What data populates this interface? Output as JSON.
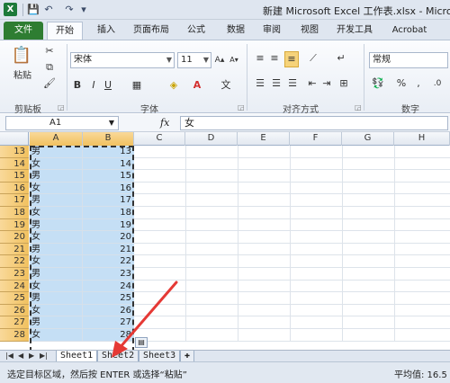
{
  "window": {
    "title": "新建 Microsoft Excel 工作表.xlsx - Microsoft"
  },
  "ribbon_tabs": [
    "文件",
    "开始",
    "插入",
    "页面布局",
    "公式",
    "数据",
    "审阅",
    "视图",
    "开发工具",
    "Acrobat"
  ],
  "clipboard": {
    "paste_label": "粘贴",
    "group_label": "剪贴板"
  },
  "font": {
    "name": "宋体",
    "size": "11",
    "group_label": "字体",
    "bold": "B",
    "italic": "I",
    "underline": "U"
  },
  "alignment": {
    "group_label": "对齐方式"
  },
  "number": {
    "format": "常规",
    "group_label": "数字",
    "percent": "%"
  },
  "formula_bar": {
    "name_box": "A1",
    "fx": "fx",
    "value": "女"
  },
  "columns": [
    "A",
    "B",
    "C",
    "D",
    "E",
    "F",
    "G",
    "H"
  ],
  "rows": [
    {
      "num": "13",
      "a": "男",
      "b": "13"
    },
    {
      "num": "14",
      "a": "女",
      "b": "14"
    },
    {
      "num": "15",
      "a": "男",
      "b": "15"
    },
    {
      "num": "16",
      "a": "女",
      "b": "16"
    },
    {
      "num": "17",
      "a": "男",
      "b": "17"
    },
    {
      "num": "18",
      "a": "女",
      "b": "18"
    },
    {
      "num": "19",
      "a": "男",
      "b": "19"
    },
    {
      "num": "20",
      "a": "女",
      "b": "20"
    },
    {
      "num": "21",
      "a": "男",
      "b": "21"
    },
    {
      "num": "22",
      "a": "女",
      "b": "22"
    },
    {
      "num": "23",
      "a": "男",
      "b": "23"
    },
    {
      "num": "24",
      "a": "女",
      "b": "24"
    },
    {
      "num": "25",
      "a": "男",
      "b": "25"
    },
    {
      "num": "26",
      "a": "女",
      "b": "26"
    },
    {
      "num": "27",
      "a": "男",
      "b": "27"
    },
    {
      "num": "28",
      "a": "女",
      "b": "28"
    }
  ],
  "sheets": [
    "Sheet1",
    "Sheet2",
    "Sheet3"
  ],
  "status": {
    "message": "选定目标区域，然后按 ENTER 或选择“粘贴”",
    "average": "平均值: 16.5"
  },
  "colors": {
    "file_tab": "#2e7d32",
    "selection": "#c5dff5",
    "annotation_arrow": "#e53935"
  }
}
